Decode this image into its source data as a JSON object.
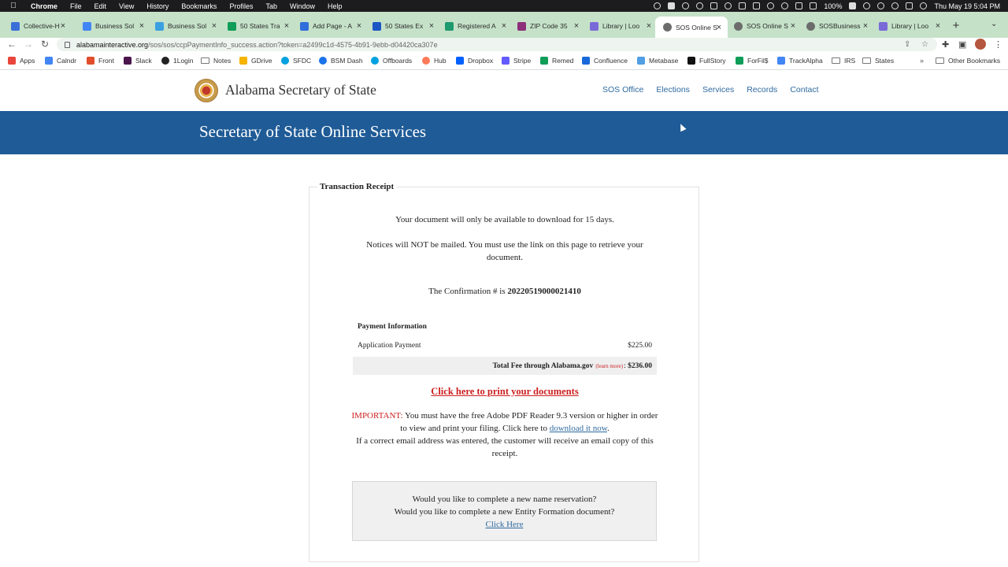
{
  "menubar": {
    "app": "Chrome",
    "items": [
      "File",
      "Edit",
      "View",
      "History",
      "Bookmarks",
      "Profiles",
      "Tab",
      "Window",
      "Help"
    ],
    "battery": "100%",
    "clock": "Thu May 19  5:04 PM"
  },
  "tabs": [
    {
      "label": "Collective-H",
      "color": "#3b6fd8"
    },
    {
      "label": "Business Sol",
      "color": "#4285f4"
    },
    {
      "label": "Business Sol",
      "color": "#3aa0e0"
    },
    {
      "label": "50 States Tra",
      "color": "#0f9d58"
    },
    {
      "label": "Add Page - A",
      "color": "#2f6edb"
    },
    {
      "label": "50 States Ex",
      "color": "#1a56c4"
    },
    {
      "label": "Registered A",
      "color": "#1e9b6e"
    },
    {
      "label": "ZIP Code 35",
      "color": "#8e2f7a"
    },
    {
      "label": "Library | Loo",
      "color": "#7a6ad8"
    },
    {
      "label": "SOS Online S",
      "color": "#6c6c6c"
    },
    {
      "label": "SOS Online S",
      "color": "#6c6c6c"
    },
    {
      "label": "SOSBusiness",
      "color": "#6c6c6c"
    },
    {
      "label": "Library | Loo",
      "color": "#7a6ad8"
    }
  ],
  "url": {
    "host": "alabamainteractive.org",
    "path": "/sos/sos/ccpPaymentInfo_success.action?token=a2499c1d-4575-4b91-9ebb-d04420ca307e"
  },
  "bookmarks": [
    {
      "label": "Apps",
      "color": "#e8453c"
    },
    {
      "label": "Calndr",
      "color": "#4285f4"
    },
    {
      "label": "Front",
      "color": "#e04e2b"
    },
    {
      "label": "Slack",
      "color": "#4a154b"
    },
    {
      "label": "1Login",
      "color": "#222222"
    },
    {
      "label": "Notes",
      "color": "folder"
    },
    {
      "label": "GDrive",
      "color": "#f4b400"
    },
    {
      "label": "SFDC",
      "color": "#00a1e0"
    },
    {
      "label": "BSM Dash",
      "color": "#1a73e8"
    },
    {
      "label": "Offboards",
      "color": "#00a1e0"
    },
    {
      "label": "Hub",
      "color": "#ff7a59"
    },
    {
      "label": "Dropbox",
      "color": "#0061ff"
    },
    {
      "label": "Stripe",
      "color": "#635bff"
    },
    {
      "label": "Remed",
      "color": "#0f9d58"
    },
    {
      "label": "Confluence",
      "color": "#1868db"
    },
    {
      "label": "Metabase",
      "color": "#509ee3"
    },
    {
      "label": "FullStory",
      "color": "#111111"
    },
    {
      "label": "ForFil$",
      "color": "#0f9d58"
    },
    {
      "label": "TrackAlpha",
      "color": "#4285f4"
    },
    {
      "label": "IRS",
      "color": "folder"
    },
    {
      "label": "States",
      "color": "folder"
    }
  ],
  "bookmarks_other": "Other Bookmarks",
  "site": {
    "title": "Alabama Secretary of State",
    "nav": [
      "SOS Office",
      "Elections",
      "Services",
      "Records",
      "Contact"
    ],
    "banner": "Secretary of State Online Services"
  },
  "receipt": {
    "legend": "Transaction Receipt",
    "notice1": "Your document will only be available to download for 15 days.",
    "notice2": "Notices will NOT be mailed. You must use the link on this page to retrieve your document.",
    "confirmation_prefix": "The Confirmation # is",
    "confirmation_number": "20220519000021410",
    "payment_heading": "Payment Information",
    "payment_label": "Application Payment",
    "payment_amount": "$225.00",
    "total_label": "Total Fee through Alabama.gov",
    "learn_more": "(learn more)",
    "total_amount": "$236.00",
    "print_link": "Click here to print your documents",
    "important_label": "IMPORTANT:",
    "important_text": "You must have the free Adobe PDF Reader 9.3 version or higher in order to view and print your filing. Click here to",
    "download_link": "download it now",
    "email_text": "If a correct email address was entered, the customer will receive an email copy of this receipt.",
    "cta_line1": "Would you like to complete a new name reservation?",
    "cta_line2": "Would you like to complete a new Entity Formation document?",
    "cta_link": "Click Here"
  }
}
